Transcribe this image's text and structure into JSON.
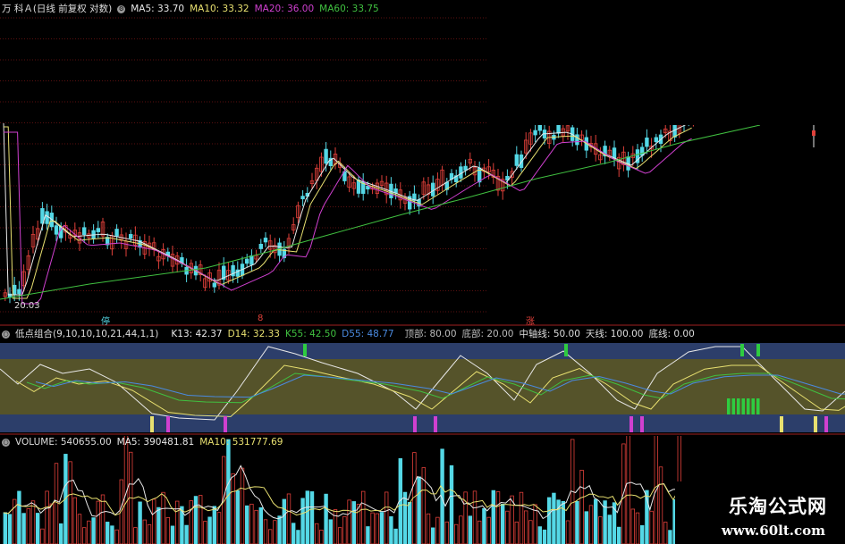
{
  "price_header": {
    "title": "万 科Ａ(日线 前复权 对数)",
    "ma5": "MA5: 33.70",
    "ma10": "MA10: 33.32",
    "ma20": "MA20: 36.00",
    "ma60": "MA60: 33.75"
  },
  "price_panel": {
    "low_label": "20.03",
    "marker_1": "停",
    "marker_2": "8",
    "marker_3": "涨"
  },
  "indicator_header": {
    "title": "低点组合(9,10,10,10,21,44,1,1)",
    "k13": "K13: 42.37",
    "d14": "D14: 32.33",
    "k55": "K55: 42.50",
    "d55": "D55: 48.77",
    "top": "顶部: 80.00",
    "bottom": "底部: 20.00",
    "mid": "中轴线: 50.00",
    "sky": "天线: 100.00",
    "floor": "底线: 0.00"
  },
  "volume_header": {
    "title": "VOLUME: 540655.00",
    "ma5": "MA5: 390481.81",
    "ma10": "MA10: 531777.69"
  },
  "watermark": {
    "name": "乐淘公式网",
    "url": "www.60lt.com"
  },
  "colors": {
    "up": "#e0403a",
    "down": "#54d8e6",
    "ma5": "#e8e8e8",
    "ma10": "#e8e070",
    "ma20": "#d040d0",
    "ma60": "#40c040",
    "band": "#55532a",
    "band_edge": "#3a5a9a"
  }
}
